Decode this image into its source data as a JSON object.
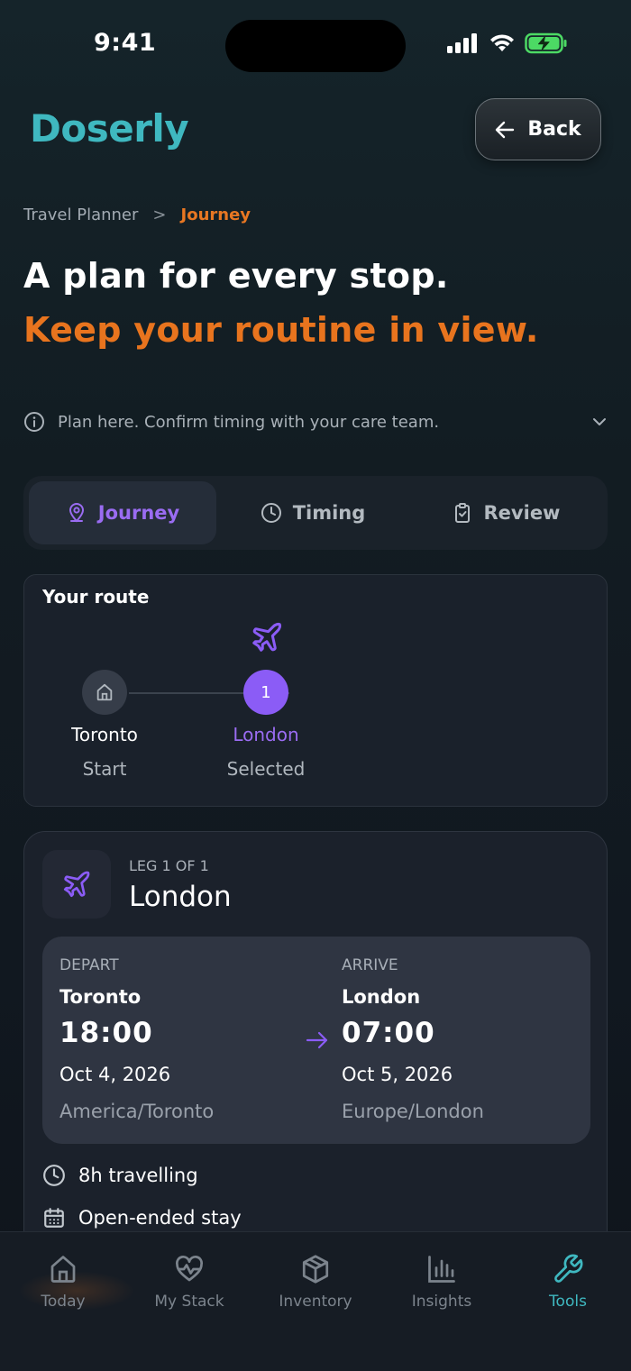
{
  "status_bar": {
    "time": "9:41"
  },
  "header": {
    "brand": "Doserly",
    "back_label": "Back"
  },
  "breadcrumb": {
    "parent": "Travel Planner",
    "separator": ">",
    "current": "Journey"
  },
  "hero": {
    "headline": "A plan for every stop.",
    "subheadline": "Keep your routine in view."
  },
  "notice": {
    "text": "Plan here. Confirm timing with your care team."
  },
  "tabs": [
    {
      "label": "Journey",
      "icon": "map-pin-icon",
      "active": true
    },
    {
      "label": "Timing",
      "icon": "clock-icon",
      "active": false
    },
    {
      "label": "Review",
      "icon": "clipboard-check-icon",
      "active": false
    }
  ],
  "route": {
    "title": "Your route",
    "stops": [
      {
        "name": "Toronto",
        "sub": "Start",
        "marker": "home-icon"
      },
      {
        "name": "London",
        "sub": "Selected",
        "marker": "1"
      }
    ]
  },
  "leg": {
    "label": "LEG 1 OF 1",
    "destination": "London",
    "depart": {
      "label": "DEPART",
      "city": "Toronto",
      "time": "18:00",
      "date": "Oct 4, 2026",
      "tz": "America/Toronto"
    },
    "arrive": {
      "label": "ARRIVE",
      "city": "London",
      "time": "07:00",
      "date": "Oct 5, 2026",
      "tz": "Europe/London"
    },
    "duration": "8h travelling",
    "stay": "Open-ended stay"
  },
  "nav": [
    {
      "label": "Today",
      "icon": "home-icon",
      "active": false
    },
    {
      "label": "My Stack",
      "icon": "heart-pulse-icon",
      "active": false
    },
    {
      "label": "Inventory",
      "icon": "box-icon",
      "active": false
    },
    {
      "label": "Insights",
      "icon": "bar-chart-icon",
      "active": false
    },
    {
      "label": "Tools",
      "icon": "wrench-icon",
      "active": true
    }
  ],
  "colors": {
    "brand": "#3fb8c0",
    "accent_orange": "#e8741e",
    "accent_purple": "#8b5cf6"
  }
}
